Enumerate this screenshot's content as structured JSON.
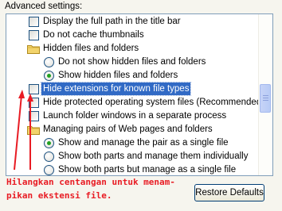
{
  "title": "Advanced settings:",
  "settings": [
    {
      "label": "Display the full path in the title bar",
      "kind": "checkbox",
      "checked": false
    },
    {
      "label": "Do not cache thumbnails",
      "kind": "checkbox",
      "checked": false
    },
    {
      "label": "Hidden files and folders",
      "kind": "folder"
    },
    {
      "label": "Do not show hidden files and folders",
      "kind": "radio",
      "checked": false
    },
    {
      "label": "Show hidden files and folders",
      "kind": "radio",
      "checked": true
    },
    {
      "label": "Hide extensions for known file types",
      "kind": "checkbox",
      "checked": false,
      "selected": true
    },
    {
      "label": "Hide protected operating system files (Recommended)",
      "kind": "checkbox",
      "checked": false
    },
    {
      "label": "Launch folder windows in a separate process",
      "kind": "checkbox",
      "checked": false
    },
    {
      "label": "Managing pairs of Web pages and folders",
      "kind": "folder"
    },
    {
      "label": "Show and manage the pair as a single file",
      "kind": "radio",
      "checked": true
    },
    {
      "label": "Show both parts and manage them individually",
      "kind": "radio",
      "checked": false
    },
    {
      "label": "Show both parts but manage as a single file",
      "kind": "radio",
      "checked": false
    }
  ],
  "annotation": {
    "line1": "Hilangkan centangan untuk menam-",
    "line2": "pikan ekstensi file."
  },
  "buttons": {
    "restore": "Restore Defaults"
  },
  "colors": {
    "annotation": "#e81c24",
    "selection": "#316ac5",
    "radio_dot": "#21a121"
  }
}
